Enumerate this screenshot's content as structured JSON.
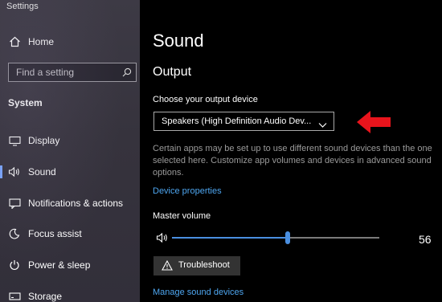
{
  "window": {
    "title": "Settings"
  },
  "sidebar": {
    "home_label": "Home",
    "search_placeholder": "Find a setting",
    "section_label": "System",
    "items": [
      {
        "label": "Display",
        "icon": "monitor-icon"
      },
      {
        "label": "Sound",
        "icon": "speaker-icon",
        "active": true
      },
      {
        "label": "Notifications & actions",
        "icon": "notification-icon"
      },
      {
        "label": "Focus assist",
        "icon": "moon-icon"
      },
      {
        "label": "Power & sleep",
        "icon": "power-icon"
      },
      {
        "label": "Storage",
        "icon": "storage-icon"
      }
    ]
  },
  "main": {
    "title": "Sound",
    "output_section": "Output",
    "device_label": "Choose your output device",
    "device_selected": "Speakers (High Definition Audio Dev...",
    "description": "Certain apps may be set up to use different sound devices than the one selected here. Customize app volumes and devices in advanced sound options.",
    "device_properties_link": "Device properties",
    "master_volume_label": "Master volume",
    "volume_value": "56",
    "volume_fraction": 0.56,
    "troubleshoot_label": "Troubleshoot",
    "manage_devices_link": "Manage sound devices"
  },
  "colors": {
    "accent": "#4a8fe0",
    "link": "#4ea6f0",
    "annotation_arrow": "#e8141c",
    "sidebar_bg": "#38353f",
    "main_bg": "#000000"
  }
}
